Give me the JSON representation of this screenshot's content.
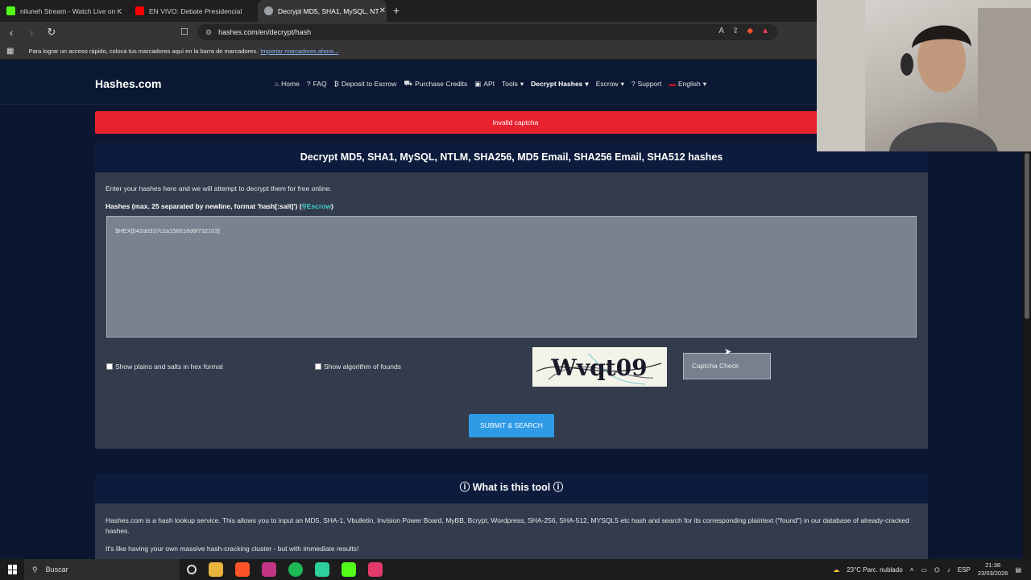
{
  "browser": {
    "tabs": [
      {
        "label": "niluneh Stream - Watch Live on K",
        "color": "#53fc18"
      },
      {
        "label": "EN VIVO: Debate Presidencial",
        "color": "#ff0000"
      },
      {
        "label": "Decrypt MD5, SHA1, MySQL, NT",
        "color": "#888888",
        "active": true
      }
    ],
    "url": "hashes.com/en/decrypt/hash",
    "bookmarks_text": "Para lograr un acceso rápido, coloca tus marcadores aquí en la barra de marcadores.",
    "bookmarks_link": "Importar marcadores ahora..."
  },
  "site": {
    "brand": "Hashes.com",
    "menu": [
      {
        "icon": "home-icon",
        "glyph": "⌂",
        "label": "Home"
      },
      {
        "icon": "question-icon",
        "glyph": "?",
        "label": "FAQ"
      },
      {
        "icon": "bitcoin-icon",
        "glyph": "₿",
        "label": "Deposit to Escrow"
      },
      {
        "icon": "cart-icon",
        "glyph": "⛟",
        "label": "Purchase Credits"
      },
      {
        "icon": "code-icon",
        "glyph": "▣",
        "label": "API"
      },
      {
        "icon": "",
        "glyph": "",
        "label": "Tools",
        "dropdown": true
      },
      {
        "icon": "",
        "glyph": "",
        "label": "Decrypt Hashes",
        "dropdown": true,
        "active": true
      },
      {
        "icon": "",
        "glyph": "",
        "label": "Escrow",
        "dropdown": true
      },
      {
        "icon": "",
        "glyph": "?",
        "label": "Support"
      },
      {
        "icon": "flag-us-icon",
        "glyph": "▬",
        "label": "English",
        "dropdown": true
      }
    ]
  },
  "alert": "Invalid captcha",
  "main": {
    "title": "Decrypt MD5, SHA1, MySQL, NTLM, SHA256, MD5 Email, SHA256 Email, SHA512 hashes",
    "intro": "Enter your hashes here and we will attempt to decrypt them for free online.",
    "hash_label": "Hashes (max. 25 separated by newline, format 'hash[:salt]') (",
    "escrow_link": "Escrow",
    "hash_value": "$HEX[042a0337c2a156616d6f732103]",
    "chk_hex": "Show plains and salts in hex format",
    "chk_algo": "Show algorithm of founds",
    "captcha_text": "Wvqt09",
    "captcha_button": "Captcha Check",
    "submit": "SUBMIT & SEARCH"
  },
  "about": {
    "title": "What is this tool",
    "p1": "Hashes.com is a hash lookup service. This allows you to input an MD5, SHA-1, Vbulletin, Invision Power Board, MyBB, Bcrypt, Wordpress, SHA-256, SHA-512, MYSQL5 etc hash and search for its corresponding plaintext (\"found\") in our database of already-cracked hashes.",
    "p2": "It's like having your own massive hash-cracking cluster - but with immediate results!"
  },
  "taskbar": {
    "search": "Buscar",
    "weather": "23°C  Parc. nublado",
    "lang": "ESP",
    "time": "21:38",
    "date": "23/03/2026"
  }
}
